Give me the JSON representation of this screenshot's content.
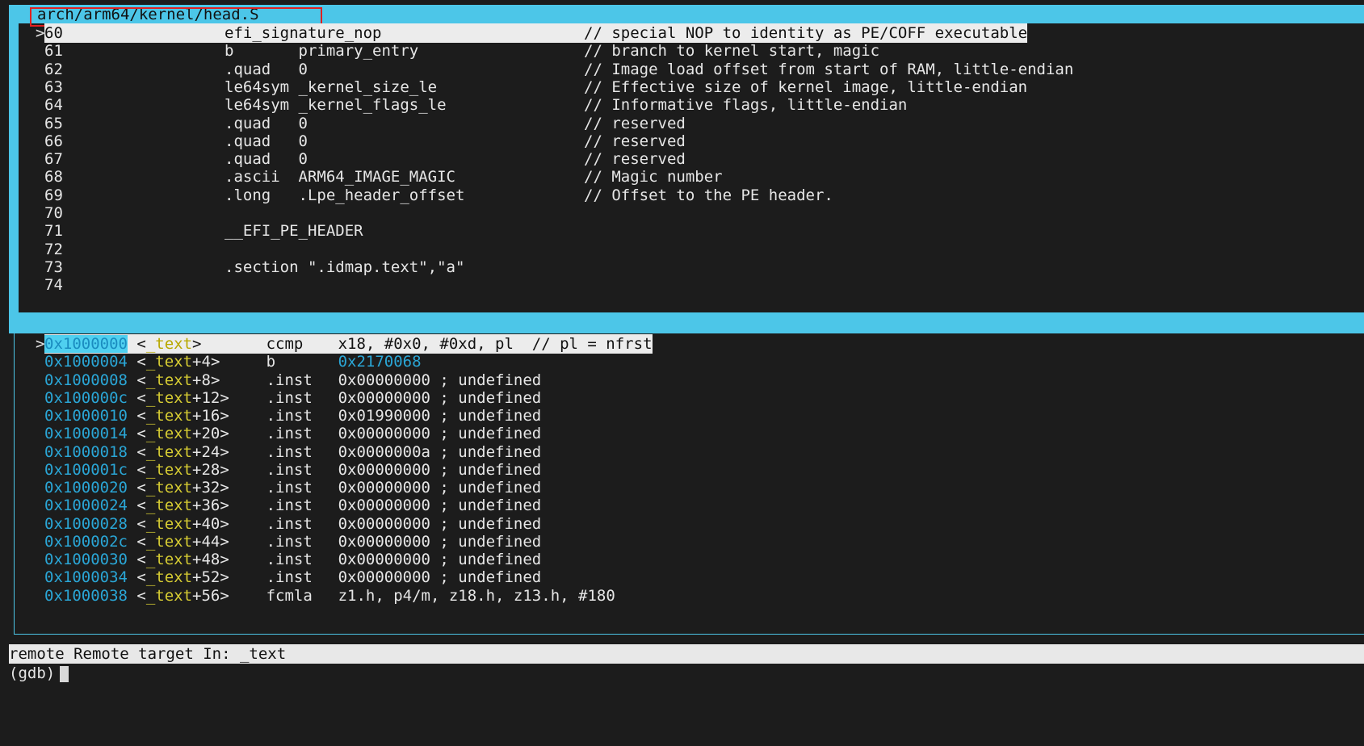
{
  "source_window": {
    "title": "arch/arm64/kernel/head.S",
    "lines": [
      {
        "marker": ">",
        "num": "60",
        "code": "efi_signature_nop",
        "comment": "// special NOP to identity as PE/COFF executable"
      },
      {
        "marker": " ",
        "num": "61",
        "code": "b       primary_entry",
        "comment": "// branch to kernel start, magic"
      },
      {
        "marker": " ",
        "num": "62",
        "code": ".quad   0",
        "comment": "// Image load offset from start of RAM, little-endian"
      },
      {
        "marker": " ",
        "num": "63",
        "code": "le64sym _kernel_size_le",
        "comment": "// Effective size of kernel image, little-endian"
      },
      {
        "marker": " ",
        "num": "64",
        "code": "le64sym _kernel_flags_le",
        "comment": "// Informative flags, little-endian"
      },
      {
        "marker": " ",
        "num": "65",
        "code": ".quad   0",
        "comment": "// reserved"
      },
      {
        "marker": " ",
        "num": "66",
        "code": ".quad   0",
        "comment": "// reserved"
      },
      {
        "marker": " ",
        "num": "67",
        "code": ".quad   0",
        "comment": "// reserved"
      },
      {
        "marker": " ",
        "num": "68",
        "code": ".ascii  ARM64_IMAGE_MAGIC",
        "comment": "// Magic number"
      },
      {
        "marker": " ",
        "num": "69",
        "code": ".long   .Lpe_header_offset",
        "comment": "// Offset to the PE header."
      },
      {
        "marker": " ",
        "num": "70",
        "code": "",
        "comment": ""
      },
      {
        "marker": " ",
        "num": "71",
        "code": "__EFI_PE_HEADER",
        "comment": ""
      },
      {
        "marker": " ",
        "num": "72",
        "code": "",
        "comment": ""
      },
      {
        "marker": " ",
        "num": "73",
        "code": ".section \".idmap.text\",\"a\"",
        "comment": ""
      },
      {
        "marker": " ",
        "num": "74",
        "code": "",
        "comment": ""
      }
    ]
  },
  "asm_window": {
    "lines": [
      {
        "marker": ">",
        "addr": "0x1000000",
        "sym": "_text",
        "off": "",
        "op": "ccmp",
        "args": "x18, #0x0, #0xd, pl  // pl = nfrst"
      },
      {
        "marker": " ",
        "addr": "0x1000004",
        "sym": "_text",
        "off": "+4",
        "op": "b",
        "args": "0x2170068"
      },
      {
        "marker": " ",
        "addr": "0x1000008",
        "sym": "_text",
        "off": "+8",
        "op": ".inst",
        "args": "0x00000000 ; undefined"
      },
      {
        "marker": " ",
        "addr": "0x100000c",
        "sym": "_text",
        "off": "+12",
        "op": ".inst",
        "args": "0x00000000 ; undefined"
      },
      {
        "marker": " ",
        "addr": "0x1000010",
        "sym": "_text",
        "off": "+16",
        "op": ".inst",
        "args": "0x01990000 ; undefined"
      },
      {
        "marker": " ",
        "addr": "0x1000014",
        "sym": "_text",
        "off": "+20",
        "op": ".inst",
        "args": "0x00000000 ; undefined"
      },
      {
        "marker": " ",
        "addr": "0x1000018",
        "sym": "_text",
        "off": "+24",
        "op": ".inst",
        "args": "0x0000000a ; undefined"
      },
      {
        "marker": " ",
        "addr": "0x100001c",
        "sym": "_text",
        "off": "+28",
        "op": ".inst",
        "args": "0x00000000 ; undefined"
      },
      {
        "marker": " ",
        "addr": "0x1000020",
        "sym": "_text",
        "off": "+32",
        "op": ".inst",
        "args": "0x00000000 ; undefined"
      },
      {
        "marker": " ",
        "addr": "0x1000024",
        "sym": "_text",
        "off": "+36",
        "op": ".inst",
        "args": "0x00000000 ; undefined"
      },
      {
        "marker": " ",
        "addr": "0x1000028",
        "sym": "_text",
        "off": "+40",
        "op": ".inst",
        "args": "0x00000000 ; undefined"
      },
      {
        "marker": " ",
        "addr": "0x100002c",
        "sym": "_text",
        "off": "+44",
        "op": ".inst",
        "args": "0x00000000 ; undefined"
      },
      {
        "marker": " ",
        "addr": "0x1000030",
        "sym": "_text",
        "off": "+48",
        "op": ".inst",
        "args": "0x00000000 ; undefined"
      },
      {
        "marker": " ",
        "addr": "0x1000034",
        "sym": "_text",
        "off": "+52",
        "op": ".inst",
        "args": "0x00000000 ; undefined"
      },
      {
        "marker": " ",
        "addr": "0x1000038",
        "sym": "_text",
        "off": "+56",
        "op": "fcmla",
        "args": "z1.h, p4/m, z18.h, z13.h, #180"
      }
    ]
  },
  "status_bar": {
    "text": "remote Remote target In: _text"
  },
  "prompt": {
    "text": "(gdb)"
  },
  "colors": {
    "frame": "#4cc6e8",
    "address": "#2aa6d6",
    "symbol": "#d6cc33",
    "title_marker": "#e02020"
  }
}
